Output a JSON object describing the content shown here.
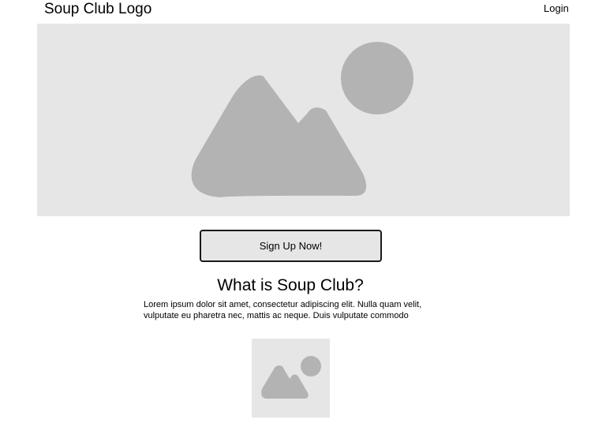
{
  "header": {
    "logo_text": "Soup Club Logo",
    "login_label": "Login"
  },
  "hero": {
    "image_icon": "image-placeholder-icon"
  },
  "cta": {
    "signup_label": "Sign Up Now!"
  },
  "about": {
    "heading": "What is Soup Club?",
    "body": "Lorem ipsum dolor sit amet, consectetur adipiscing elit. Nulla quam velit, vulputate eu pharetra nec, mattis ac neque. Duis vulputate commodo",
    "image_icon": "image-placeholder-icon"
  },
  "colors": {
    "placeholder_bg": "#e6e6e6",
    "placeholder_icon": "#b3b3b3",
    "button_border": "#1a1a1a"
  }
}
